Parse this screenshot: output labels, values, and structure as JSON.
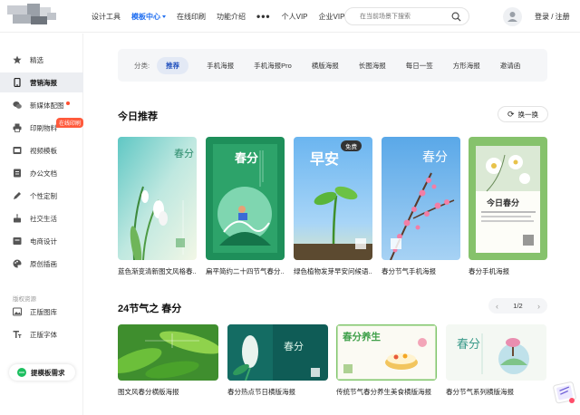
{
  "header": {
    "nav": [
      "设计工具",
      "模板中心",
      "在线印刷",
      "功能介绍",
      "个人VIP",
      "企业VIP"
    ],
    "nav_active": "模板中心",
    "more": "•••",
    "search_placeholder": "在当前场景下搜索",
    "login": "登录 / 注册"
  },
  "sidebar": {
    "items": [
      "精选",
      "营销海报",
      "新媒体配图",
      "印刷物料",
      "视频模板",
      "办公文档",
      "个性定制",
      "社交生活",
      "电商设计",
      "原创插画"
    ],
    "active": "营销海报",
    "print_badge": "在线印刷",
    "section_label": "版权资源",
    "resources": [
      "正版图库",
      "正版字体"
    ],
    "request_button": "提模板需求"
  },
  "categories": {
    "label": "分类:",
    "items": [
      "推荐",
      "手机海报",
      "手机海报Pro",
      "横版海报",
      "长图海报",
      "每日一签",
      "方形海报",
      "邀请函"
    ],
    "active": "推荐"
  },
  "today": {
    "title": "今日推荐",
    "refresh_label": "换一换",
    "cards": [
      {
        "title": "蓝色渐变清新图文风格春..."
      },
      {
        "title": "扁平简约二十四节气春分..."
      },
      {
        "title": "绿色植物发芽早安问候语...",
        "badge": "免费"
      },
      {
        "title": "春分节气手机海报"
      },
      {
        "title": "春分手机海报"
      }
    ],
    "poster_text": {
      "p1": "春分",
      "p2": "春分",
      "p3": "早安",
      "p4": "春分",
      "p5": "今日春分"
    }
  },
  "solar_terms": {
    "title": "24节气之 春分",
    "page": "1/2",
    "cards": [
      {
        "title": "图文风春分横版海报"
      },
      {
        "title": "春分热点节日横版海报",
        "poster": "春分"
      },
      {
        "title": "传统节气春分养生美食横版海报",
        "poster": "春分养生"
      },
      {
        "title": "春分节气系列横版海报",
        "poster": "春分"
      }
    ]
  },
  "colors": {
    "accent": "#1f6ef0",
    "badge": "#ff5a3c",
    "green": "#1dbf60"
  }
}
